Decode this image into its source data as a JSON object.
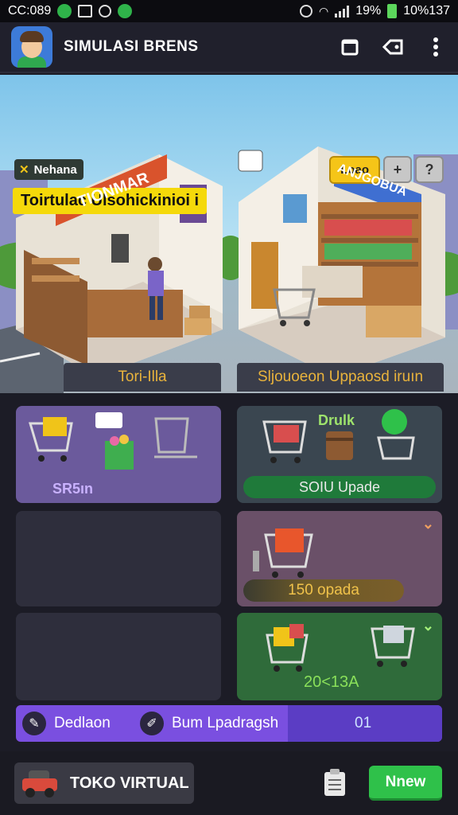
{
  "status_bar": {
    "left_time": "CC:089",
    "right_battery": "19%",
    "right_time": "10%137"
  },
  "header": {
    "title": "SIMULASI BRENS"
  },
  "scene": {
    "tag": "Nehana",
    "title": "Toirtulac Ulsohickinioi i",
    "buttons": {
      "primary": "Loao",
      "plus": "+",
      "help": "?"
    },
    "sign_left": "TIONMAR",
    "sign_right": "ANJGOBUA",
    "caption_left": "Tori-Illa",
    "caption_right": "Sljouoeon Uppaosd iruın"
  },
  "cards": {
    "c1_label": "SR5ın",
    "c2_label": "Drulk",
    "c2_button": "SOIU Upade",
    "c4_button": "150 opada",
    "c6_value": "20<13A"
  },
  "upgrade_bar": {
    "first": "Dedlaon",
    "second": "Bum Lpadragsh",
    "count": "01"
  },
  "bottom": {
    "store_label": "TOKO VIRTUAL",
    "new_button": "Nnew"
  },
  "colors": {
    "accent_green": "#2fc14a",
    "accent_purple": "#7a4fe0",
    "accent_yellow": "#f5d90a"
  }
}
